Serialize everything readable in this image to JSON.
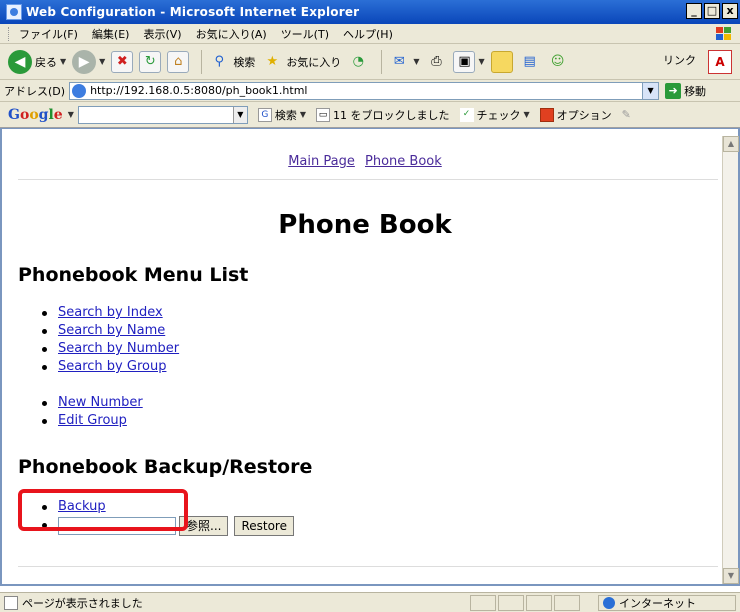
{
  "window": {
    "title": "Web Configuration - Microsoft Internet Explorer",
    "min_glyph": "_",
    "max_glyph": "□",
    "close_glyph": "x"
  },
  "menubar": {
    "items": [
      "ファイル(F)",
      "編集(E)",
      "表示(V)",
      "お気に入り(A)",
      "ツール(T)",
      "ヘルプ(H)"
    ]
  },
  "toolbar": {
    "back_label": "戻る",
    "search_label": "検索",
    "favorites_label": "お気に入り",
    "links_label": "リンク"
  },
  "address": {
    "label": "アドレス(D)",
    "url": "http://192.168.0.5:8080/ph_book1.html",
    "go_label": "移動"
  },
  "googlebar": {
    "logo": [
      "G",
      "o",
      "o",
      "g",
      "l",
      "e"
    ],
    "search_label": "検索",
    "blocked_label": "11 をブロックしました",
    "check_label": "チェック",
    "options_label": "オプション"
  },
  "page": {
    "nav_links": [
      "Main Page",
      "Phone Book"
    ],
    "title": "Phone Book",
    "menu_heading": "Phonebook Menu List",
    "search_links": [
      "Search by Index",
      "Search by Name",
      "Search by Number",
      "Search by Group"
    ],
    "edit_links": [
      "New Number",
      "Edit Group"
    ],
    "backup_heading": "Phonebook Backup/Restore",
    "backup_link": "Backup",
    "browse_button": "参照...",
    "restore_button": "Restore"
  },
  "status": {
    "text": "ページが表示されました",
    "zone": "インターネット"
  },
  "colors": {
    "titlebar": "#0a46b9",
    "link": "#2020c0",
    "visited_link": "#4a2b9a",
    "highlight": "#e8141c"
  }
}
